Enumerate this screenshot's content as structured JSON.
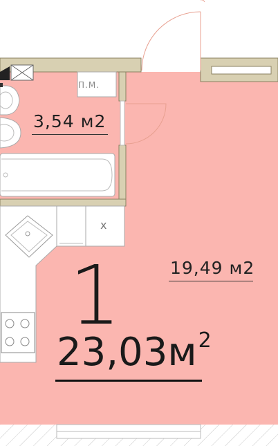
{
  "plan": {
    "apartment_number": "1",
    "total_area": "23,03м",
    "total_area_sup": "2",
    "rooms": [
      {
        "name": "bathroom",
        "area": "3,54 м2"
      },
      {
        "name": "living-room",
        "area": "19,49 м2"
      }
    ],
    "labels": {
      "utility": "П.М.",
      "mark": "x"
    }
  },
  "colors": {
    "floor": "#fbb6b0",
    "wall": "#d8d0b2",
    "wall_stroke": "#8a8060",
    "fixture_stroke": "#aaaaaa",
    "hatch": "#c8c8c8"
  }
}
